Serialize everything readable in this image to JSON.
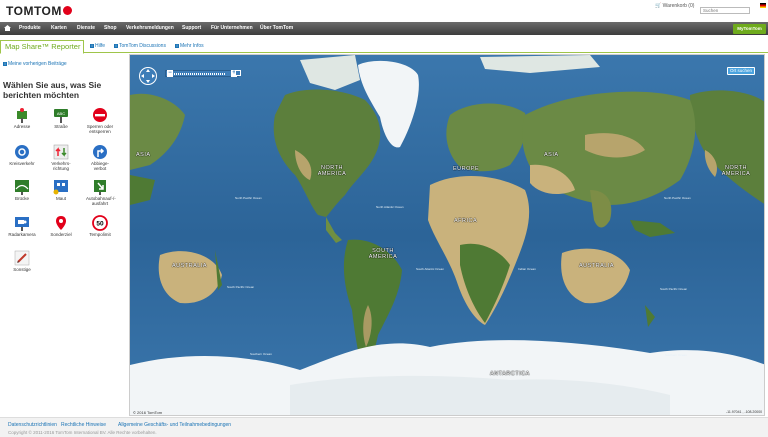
{
  "header": {
    "logo": "TOMTOM",
    "cart": "Warenkorb (0)",
    "search_placeholder": "Suchen"
  },
  "nav": {
    "items": [
      "Produkte",
      "Karten",
      "Dienste",
      "Shop",
      "Verkehrsmeldungen",
      "Support",
      "Für Unternehmen",
      "Über TomTom"
    ],
    "my_tomtom": "MyTomTom"
  },
  "subnav": {
    "tab": "Map Share™ Reporter",
    "links": [
      "Hilfe",
      "TomTom Discussions",
      "Mehr Infos"
    ]
  },
  "sidebar": {
    "previous": "Meine vorherigen Beiträge",
    "heading": "Wählen Sie aus, was Sie berichten möchten",
    "categories": [
      {
        "label": "Adresse",
        "icon": "address-pin-icon"
      },
      {
        "label": "Straße",
        "icon": "street-sign-icon"
      },
      {
        "label": "Sperren oder entsperren",
        "icon": "block-road-icon"
      },
      {
        "label": "Kreisverkehr",
        "icon": "roundabout-icon"
      },
      {
        "label": "Verkehrs-richtung",
        "icon": "traffic-direction-icon"
      },
      {
        "label": "Abbiege-verbot",
        "icon": "turn-restriction-icon"
      },
      {
        "label": "Brücke",
        "icon": "bridge-icon"
      },
      {
        "label": "Maut",
        "icon": "toll-icon"
      },
      {
        "label": "Autobahnauf-/-ausfahrt",
        "icon": "motorway-exit-icon"
      },
      {
        "label": "Radarkamera",
        "icon": "speed-camera-icon"
      },
      {
        "label": "Sonderziel",
        "icon": "poi-icon"
      },
      {
        "label": "Tempolimit",
        "icon": "speed-limit-icon"
      },
      {
        "label": "Sonstige",
        "icon": "other-icon"
      }
    ],
    "speed_limit_value": "50"
  },
  "map": {
    "find_button": "Ort suchen",
    "continents": [
      "ASIA",
      "NORTH AMERICA",
      "EUROPE",
      "ASIA",
      "NORTH AMERICA",
      "AFRICA",
      "SOUTH AMERICA",
      "AUSTRALIA",
      "AUSTRALIA",
      "ANTARCTICA"
    ],
    "oceans": [
      "North Pacific Ocean",
      "North Atlantic Ocean",
      "North Pacific Ocean",
      "South Pacific Ocean",
      "South Atlantic Ocean",
      "Indian Ocean",
      "South Pacific Ocean",
      "Southern Ocean",
      "Southern Ocean"
    ],
    "copyright": "© 2016 TomTom",
    "coordinates": "-11.97041 , -108.20000",
    "colors": {
      "ocean": "#2f6aa0",
      "land_green": "#5c7f3c",
      "desert": "#c9b27c",
      "ice": "#f2f5f7"
    }
  },
  "footer": {
    "links": [
      "Datenschutzrichtlinien",
      "Rechtliche Hinweise",
      "Allgemeine Geschäfts- und Teilnahmebedingungen"
    ],
    "copyright": "Copyright © 2011-2016 TomTom International BV. Alle Rechte vorbehalten."
  }
}
